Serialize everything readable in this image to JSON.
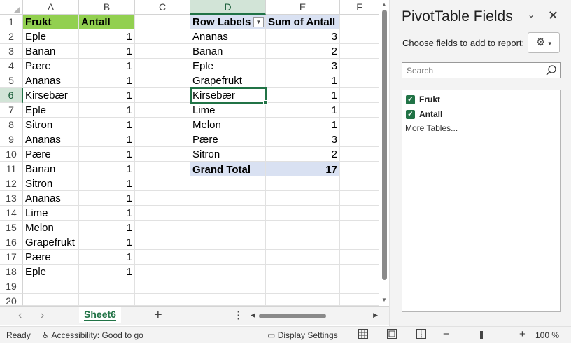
{
  "columns": [
    "A",
    "B",
    "C",
    "D",
    "E",
    "F"
  ],
  "row_numbers": [
    "1",
    "2",
    "3",
    "4",
    "5",
    "6",
    "7",
    "8",
    "9",
    "10",
    "11",
    "12",
    "13",
    "14",
    "15",
    "16",
    "17",
    "18",
    "19",
    "20"
  ],
  "source": {
    "header": [
      "Frukt",
      "Antall"
    ],
    "rows": [
      [
        "Eple",
        "1"
      ],
      [
        "Banan",
        "1"
      ],
      [
        "Pære",
        "1"
      ],
      [
        "Ananas",
        "1"
      ],
      [
        "Kirsebær",
        "1"
      ],
      [
        "Eple",
        "1"
      ],
      [
        "Sitron",
        "1"
      ],
      [
        "Ananas",
        "1"
      ],
      [
        "Pære",
        "1"
      ],
      [
        "Banan",
        "1"
      ],
      [
        "Sitron",
        "1"
      ],
      [
        "Ananas",
        "1"
      ],
      [
        "Lime",
        "1"
      ],
      [
        "Melon",
        "1"
      ],
      [
        "Grapefrukt",
        "1"
      ],
      [
        "Pære",
        "1"
      ],
      [
        "Eple",
        "1"
      ]
    ]
  },
  "pivot": {
    "header": [
      "Row Labels",
      "Sum of Antall"
    ],
    "rows": [
      [
        "Ananas",
        "3"
      ],
      [
        "Banan",
        "2"
      ],
      [
        "Eple",
        "3"
      ],
      [
        "Grapefrukt",
        "1"
      ],
      [
        "Kirsebær",
        "1"
      ],
      [
        "Lime",
        "1"
      ],
      [
        "Melon",
        "1"
      ],
      [
        "Pære",
        "3"
      ],
      [
        "Sitron",
        "2"
      ]
    ],
    "total": [
      "Grand Total",
      "17"
    ]
  },
  "sheet_tab": "Sheet6",
  "status": {
    "ready": "Ready",
    "accessibility": "Accessibility: Good to go",
    "display_settings": "Display Settings",
    "zoom": "100 %"
  },
  "pane": {
    "title": "PivotTable Fields",
    "prompt": "Choose fields to add to report:",
    "search_placeholder": "Search",
    "fields": [
      "Frukt",
      "Antall"
    ],
    "more_tables": "More Tables..."
  },
  "colors": {
    "accent": "#217346",
    "header_green": "#92d050",
    "pivot_header": "#d9e1f2"
  }
}
